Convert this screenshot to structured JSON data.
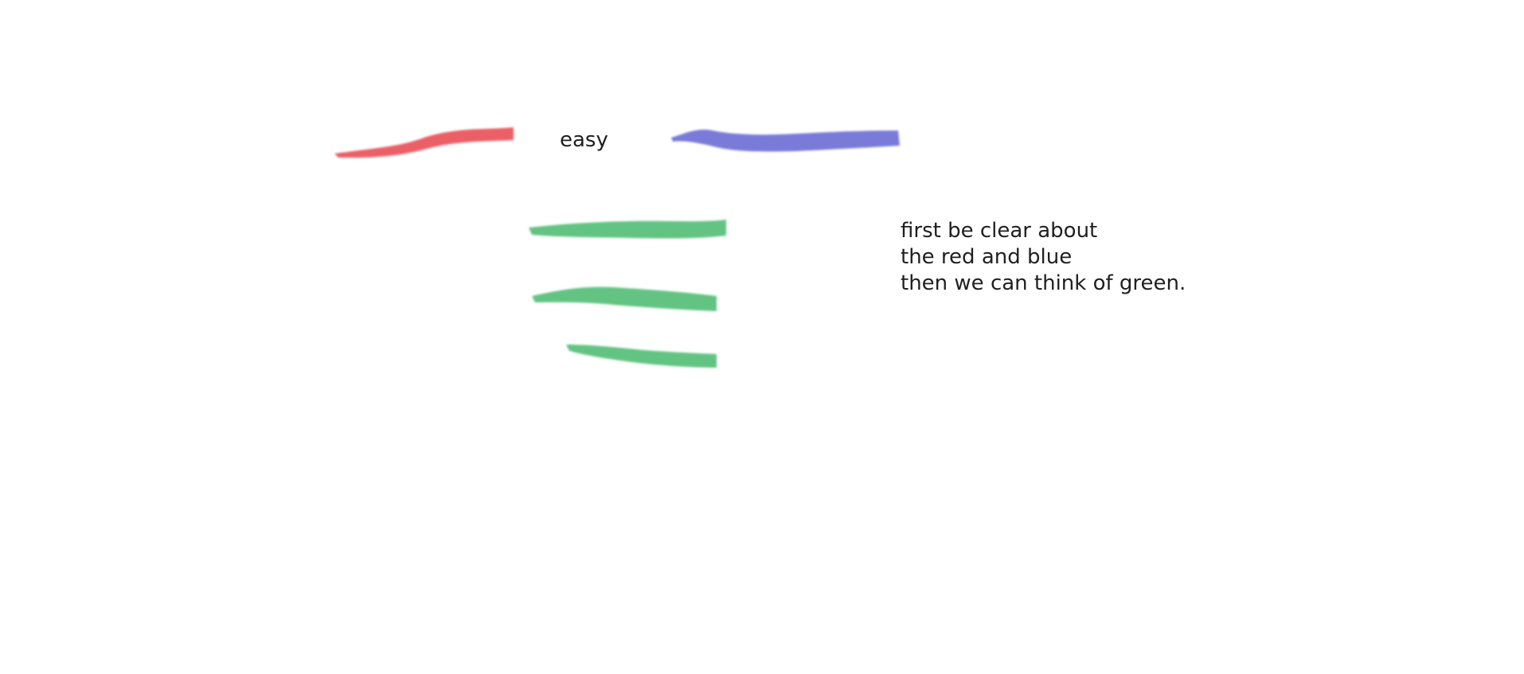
{
  "label": "easy",
  "note": {
    "lines": [
      "first be clear about",
      "the red and blue",
      "then we can think of green."
    ]
  },
  "colors": {
    "red": "#e8454d",
    "blue": "#5d5fd0",
    "green": "#3fb768",
    "text": "#1f1f1f",
    "background": "#ffffff"
  }
}
